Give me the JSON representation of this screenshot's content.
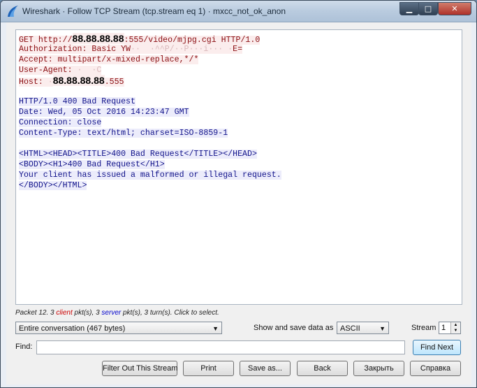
{
  "window": {
    "title": "Wireshark · Follow TCP Stream (tcp.stream eq 1) · mxcc_not_ok_anon",
    "controls": {
      "minimize": "▁",
      "maximize": "□",
      "close": "✕"
    }
  },
  "stream": {
    "client_lines": [
      {
        "pre": "GET http://",
        "ip": "88.88.88.88",
        "post": ":555/video/mjpg.cgi HTTP/1.0"
      },
      {
        "pre": "Authorization: Basic YW",
        "blur": "··  ·^^P/··P···i··· ·",
        "post": "E="
      },
      {
        "pre": "Accept: multipart/x-mixed-replace,*/*"
      },
      {
        "pre": "User-Agent: ",
        "blur": "·  ·C"
      },
      {
        "pre": "Host: ",
        "blur": "·",
        "ip": "88.88.88.88",
        "post": ".555"
      }
    ],
    "server_lines": [
      "HTTP/1.0 400 Bad Request",
      "Date: Wed, 05 Oct 2016 14:23:47 GMT",
      "Connection: close",
      "Content-Type: text/html; charset=ISO-8859-1",
      "",
      "<HTML><HEAD><TITLE>400 Bad Request</TITLE></HEAD>",
      "<BODY><H1>400 Bad Request</H1>",
      "Your client has issued a malformed or illegal request.",
      "</BODY></HTML>"
    ]
  },
  "status": {
    "prefix": "Packet 12. 3 ",
    "client": "client",
    "middle": " pkt(s), 3 ",
    "server": "server",
    "suffix": " pkt(s), 3 turn(s). Click to select."
  },
  "controls": {
    "conversation": "Entire conversation (467 bytes)",
    "show_as_label": "Show and save data as",
    "show_as_value": "ASCII",
    "stream_label": "Stream",
    "stream_value": "1",
    "find_label": "Find:",
    "find_value": "",
    "find_next": "Find Next"
  },
  "buttons": {
    "filter_out": "Filter Out This Stream",
    "print": "Print",
    "save_as": "Save as...",
    "back": "Back",
    "close": "Закрыть",
    "help": "Справка"
  },
  "colors": {
    "client": "#8a0c10",
    "server": "#10128a"
  }
}
